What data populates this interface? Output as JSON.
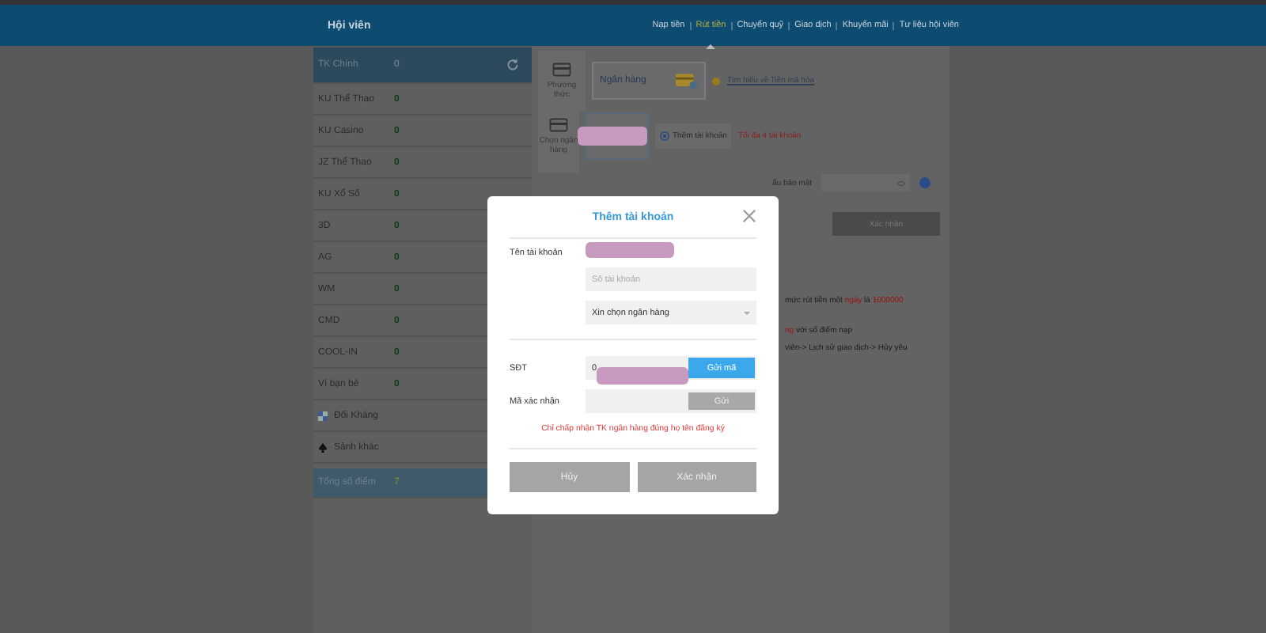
{
  "header": {
    "title": "Hội viên"
  },
  "nav": [
    {
      "label": "Nạp tiền",
      "selected": false
    },
    {
      "label": "Rút tiền",
      "selected": true
    },
    {
      "label": "Chuyển quỹ",
      "selected": false
    },
    {
      "label": "Giao dịch",
      "selected": false
    },
    {
      "label": "Khuyến mãi",
      "selected": false
    },
    {
      "label": "Tư liệu hội viên",
      "selected": false
    }
  ],
  "sidebar": {
    "items": [
      {
        "kind": "main",
        "label": "TK Chính",
        "value": "0",
        "selected": true
      },
      {
        "kind": "balance",
        "label": "KU Thể Thao",
        "value": "0"
      },
      {
        "kind": "balance",
        "label": "KU Casino",
        "value": "0"
      },
      {
        "kind": "balance",
        "label": "JZ Thể Thao",
        "value": "0"
      },
      {
        "kind": "balance",
        "label": "KU Xổ Số",
        "value": "0"
      },
      {
        "kind": "balance",
        "label": "3D",
        "value": "0"
      },
      {
        "kind": "balance",
        "label": "AG",
        "value": "0"
      },
      {
        "kind": "balance",
        "label": "WM",
        "value": "0"
      },
      {
        "kind": "balance",
        "label": "CMD",
        "value": "0"
      },
      {
        "kind": "balance",
        "label": "COOL-IN",
        "value": "0"
      },
      {
        "kind": "balance",
        "label": "Ví bạn bè",
        "value": "0"
      },
      {
        "kind": "versus",
        "label": "Đối Kháng"
      },
      {
        "kind": "lobby",
        "label": "Sảnh khác"
      },
      {
        "kind": "total",
        "label": "Tổng số điểm",
        "value": "7"
      }
    ]
  },
  "method": {
    "label": "Phương thức",
    "option": "Ngân hàng",
    "link": "Tìm hiểu về Tiền mã hóa"
  },
  "bank": {
    "label": "Chọn ngân hàng",
    "add_button": "Thêm tài khoản",
    "limit": "Tối đa 4 tài khoản"
  },
  "password": {
    "label": "ẩu bảo mật"
  },
  "submit_button": "Xác nhận",
  "notes": [
    [
      {
        "text": "mức rút tiền một ",
        "red": false
      },
      {
        "text": "ngày",
        "red": true
      },
      {
        "text": " là ",
        "red": false
      },
      {
        "text": "1000000",
        "red": true
      }
    ],
    [
      {
        "text": "ng",
        "red": true
      },
      {
        "text": " với số điểm nạp",
        "red": false
      }
    ],
    [
      {
        "text": "viên-> Lịch sử giao dịch-> Hủy yêu",
        "red": false
      }
    ]
  ],
  "dialog": {
    "title": "Thêm tài khoản",
    "name_label": "Tên tài khoản",
    "account_placeholder": "Số tài khoản",
    "bank_select": "Xin chọn ngân hàng",
    "phone_label": "SĐT",
    "phone_value": "0",
    "send_code_button": "Gửi mã",
    "code_label": "Mã xác nhận",
    "send_button": "Gửi",
    "warning": "Chỉ chấp nhận TK ngân hàng đúng họ tên đăng ký",
    "cancel_button": "Hủy",
    "confirm_button": "Xác nhận"
  }
}
